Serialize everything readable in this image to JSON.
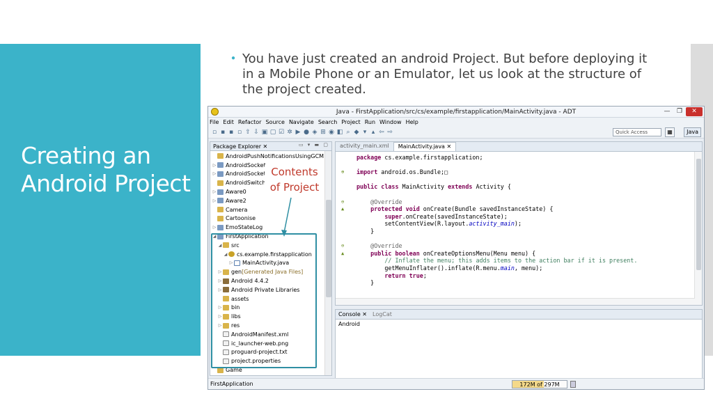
{
  "slide": {
    "title": "Creating an Android Project",
    "bullet": "You have just created an android Project. But before deploying it in a Mobile Phone or an Emulator, let us look at the structure of the project created.",
    "callout": "Contents of Project",
    "accent_color": "#3bb3c9",
    "callout_color": "#c0392b"
  },
  "window": {
    "title": "Java - FirstApplication/src/cs/example/firstapplication/MainActivity.java - ADT",
    "close_glyph": "✕",
    "max_glyph": "❐",
    "min_glyph": "—"
  },
  "menu": [
    "File",
    "Edit",
    "Refactor",
    "Source",
    "Navigate",
    "Search",
    "Project",
    "Run",
    "Window",
    "Help"
  ],
  "toolbar": {
    "quick_access_placeholder": "Quick Access",
    "perspective_label": "Java"
  },
  "package_explorer": {
    "tab_label": "Package Explorer ✕",
    "items": [
      {
        "label": "AndroidPushNotificationsUsingGCM",
        "depth": 0,
        "twisty": "",
        "icon": "folder"
      },
      {
        "label": "AndroidSocket",
        "depth": 0,
        "twisty": "▷",
        "icon": "proj"
      },
      {
        "label": "AndroidSocket",
        "depth": 0,
        "twisty": "▷",
        "icon": "proj"
      },
      {
        "label": "AndroidSwitch",
        "depth": 0,
        "twisty": "",
        "icon": "folder"
      },
      {
        "label": "Aware0",
        "depth": 0,
        "twisty": "▷",
        "icon": "proj"
      },
      {
        "label": "Aware2",
        "depth": 0,
        "twisty": "▷",
        "icon": "proj"
      },
      {
        "label": "Camera",
        "depth": 0,
        "twisty": "",
        "icon": "folder"
      },
      {
        "label": "Cartoonise",
        "depth": 0,
        "twisty": "",
        "icon": "folder"
      },
      {
        "label": "EmoStateLog",
        "depth": 0,
        "twisty": "▷",
        "icon": "proj"
      },
      {
        "label": "FirstApplication",
        "depth": 0,
        "twisty": "◢",
        "icon": "proj"
      },
      {
        "label": "src",
        "depth": 1,
        "twisty": "◢",
        "icon": "folder"
      },
      {
        "label": "cs.example.firstapplication",
        "depth": 2,
        "twisty": "◢",
        "icon": "pkgi"
      },
      {
        "label": "MainActivity.java",
        "depth": 3,
        "twisty": "▷",
        "icon": "java"
      },
      {
        "label": "gen",
        "suffix": " [Generated Java Files]",
        "depth": 1,
        "twisty": "▷",
        "icon": "folder"
      },
      {
        "label": "Android 4.4.2",
        "depth": 1,
        "twisty": "▷",
        "icon": "lib"
      },
      {
        "label": "Android Private Libraries",
        "depth": 1,
        "twisty": "▷",
        "icon": "lib"
      },
      {
        "label": "assets",
        "depth": 1,
        "twisty": "",
        "icon": "folder"
      },
      {
        "label": "bin",
        "depth": 1,
        "twisty": "▷",
        "icon": "folder"
      },
      {
        "label": "libs",
        "depth": 1,
        "twisty": "▷",
        "icon": "folder"
      },
      {
        "label": "res",
        "depth": 1,
        "twisty": "▷",
        "icon": "folder"
      },
      {
        "label": "AndroidManifest.xml",
        "depth": 1,
        "twisty": "",
        "icon": "file"
      },
      {
        "label": "ic_launcher-web.png",
        "depth": 1,
        "twisty": "",
        "icon": "file"
      },
      {
        "label": "proguard-project.txt",
        "depth": 1,
        "twisty": "",
        "icon": "file"
      },
      {
        "label": "project.properties",
        "depth": 1,
        "twisty": "",
        "icon": "file"
      },
      {
        "label": "Game",
        "depth": 0,
        "twisty": "",
        "icon": "folder"
      }
    ]
  },
  "editor": {
    "tabs": [
      {
        "label": "activity_main.xml",
        "active": false
      },
      {
        "label": "MainActivity.java ✕",
        "active": true
      }
    ],
    "lines": {
      "l1_kw": "package",
      "l1_rest": " cs.example.firstapplication;",
      "l3_mark": "⊕",
      "l3_kw": "import",
      "l3_rest": " android.os.Bundle;□",
      "l5_kw1": "public class",
      "l5_mid": " MainActivity ",
      "l5_kw2": "extends",
      "l5_rest": " Activity {",
      "l7_mark": "⊖",
      "l7_ann": "@Override",
      "l8_mark": "▲",
      "l8_kw": "protected void",
      "l8_rest": " onCreate(Bundle savedInstanceState) {",
      "l9_kw": "super",
      "l9_rest": ".onCreate(savedInstanceState);",
      "l10_pre": "setContentView(R.layout.",
      "l10_fld": "activity_main",
      "l10_post": ");",
      "l11": "}",
      "l13_mark": "⊖",
      "l13_ann": "@Override",
      "l14_mark": "▲",
      "l14_kw1": "public boolean",
      "l14_rest": " onCreateOptionsMenu(Menu menu) {",
      "l15_cm": "// Inflate the menu; this adds items to the action bar if it is present.",
      "l16_pre": "getMenuInflater().inflate(R.menu.",
      "l16_fld": "main",
      "l16_post": ", menu);",
      "l17_kw": "return true",
      "l17_post": ";",
      "l18": "}"
    }
  },
  "console": {
    "tab_console": "Console ✕",
    "tab_logcat": "LogCat",
    "body": "Android"
  },
  "status": {
    "left": "FirstApplication",
    "heap": "172M of 297M"
  }
}
